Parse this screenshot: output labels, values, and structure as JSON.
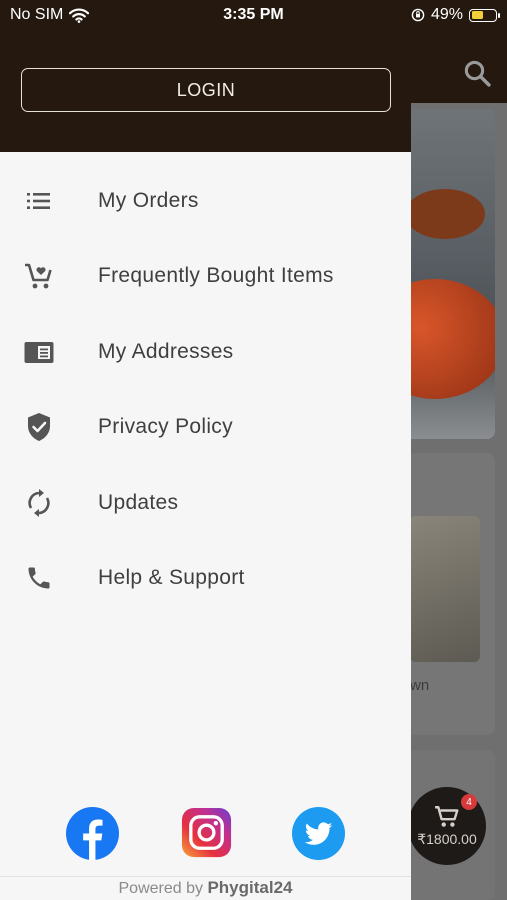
{
  "status_bar": {
    "carrier": "No SIM",
    "time": "3:35 PM",
    "battery_percent": "49%",
    "battery_level": 0.49,
    "battery_color": "#f2cf3a"
  },
  "drawer": {
    "login_label": "LOGIN",
    "menu": [
      {
        "label": "My Orders",
        "icon": "list-icon"
      },
      {
        "label": "Frequently Bought Items",
        "icon": "cart-heart-icon"
      },
      {
        "label": "My Addresses",
        "icon": "address-card-icon"
      },
      {
        "label": "Privacy Policy",
        "icon": "shield-check-icon"
      },
      {
        "label": "Updates",
        "icon": "refresh-icon"
      },
      {
        "label": "Help & Support",
        "icon": "phone-icon"
      }
    ],
    "social": [
      "facebook-icon",
      "instagram-icon",
      "twitter-icon"
    ],
    "powered_by_prefix": "Powered by",
    "powered_by_brand": "Phygital24"
  },
  "background": {
    "card_text_fragment": "wn",
    "cart_amount": "₹1800.00",
    "cart_count": "4"
  },
  "colors": {
    "header_dark": "#24180f",
    "drawer_bg": "#f6f6f6",
    "facebook": "#1877f2",
    "twitter": "#1d9bf0"
  }
}
